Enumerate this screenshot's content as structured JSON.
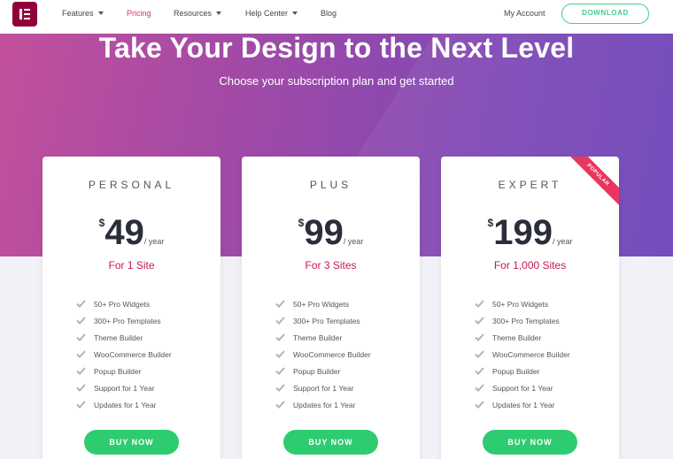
{
  "header": {
    "nav": [
      {
        "label": "Features",
        "dropdown": true
      },
      {
        "label": "Pricing",
        "dropdown": false,
        "active": true
      },
      {
        "label": "Resources",
        "dropdown": true
      },
      {
        "label": "Help Center",
        "dropdown": true
      },
      {
        "label": "Blog",
        "dropdown": false
      }
    ],
    "account_label": "My Account",
    "download_label": "DOWNLOAD"
  },
  "hero": {
    "title": "Take Your Design to the Next Level",
    "subtitle": "Choose your subscription plan and get started"
  },
  "plans": [
    {
      "name": "PERSONAL",
      "currency": "$",
      "price": "49",
      "period": "/ year",
      "sites": "For 1 Site",
      "features": [
        "50+ Pro Widgets",
        "300+ Pro Templates",
        "Theme Builder",
        "WooCommerce Builder",
        "Popup Builder",
        "Support for 1 Year",
        "Updates for 1 Year"
      ],
      "button": "BUY NOW"
    },
    {
      "name": "PLUS",
      "currency": "$",
      "price": "99",
      "period": "/ year",
      "sites": "For 3 Sites",
      "features": [
        "50+ Pro Widgets",
        "300+ Pro Templates",
        "Theme Builder",
        "WooCommerce Builder",
        "Popup Builder",
        "Support for 1 Year",
        "Updates for 1 Year"
      ],
      "button": "BUY NOW"
    },
    {
      "name": "EXPERT",
      "currency": "$",
      "price": "199",
      "period": "/ year",
      "sites": "For 1,000 Sites",
      "badge": "POPULAR",
      "features": [
        "50+ Pro Widgets",
        "300+ Pro Templates",
        "Theme Builder",
        "WooCommerce Builder",
        "Popup Builder",
        "Support for 1 Year",
        "Updates for 1 Year"
      ],
      "button": "BUY NOW"
    }
  ],
  "colors": {
    "brand": "#92003b",
    "accent_pink": "#d6336c",
    "sites_text": "#c2185b",
    "buy_button": "#2ecc71",
    "download_outline": "#3ecf8e",
    "ribbon": "#e8365f",
    "check": "#b3b3b3"
  },
  "icons": {
    "logo": "elementor-logo-icon",
    "dropdown": "caret-down-icon",
    "feature": "check-icon"
  }
}
